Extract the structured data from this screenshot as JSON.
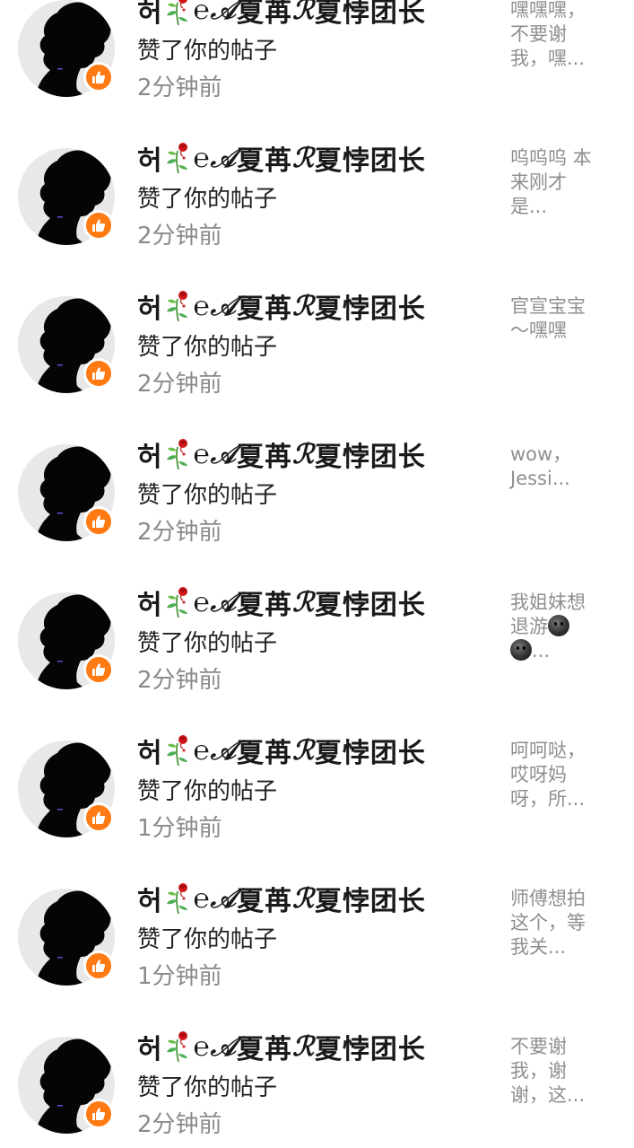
{
  "notifications": [
    {
      "name_prefix": "허",
      "name_script": "℮𝒜",
      "name_mid": "夏苒",
      "name_script2": "ℛ",
      "name_suffix": "夏悖团长",
      "action": "赞了你的帖子",
      "time": "2分钟前",
      "preview_lines": [
        "嘿嘿嘿，",
        "不要谢",
        "我，嘿..."
      ]
    },
    {
      "name_prefix": "허",
      "name_script": "℮𝒜",
      "name_mid": "夏苒",
      "name_script2": "ℛ",
      "name_suffix": "夏悖团长",
      "action": "赞了你的帖子",
      "time": "2分钟前",
      "preview_lines": [
        "呜呜呜  本",
        "来刚才",
        "是..."
      ]
    },
    {
      "name_prefix": "허",
      "name_script": "℮𝒜",
      "name_mid": "夏苒",
      "name_script2": "ℛ",
      "name_suffix": "夏悖团长",
      "action": "赞了你的帖子",
      "time": "2分钟前",
      "preview_lines": [
        "官宣宝宝",
        "～嘿嘿"
      ]
    },
    {
      "name_prefix": "허",
      "name_script": "℮𝒜",
      "name_mid": "夏苒",
      "name_script2": "ℛ",
      "name_suffix": "夏悖团长",
      "action": "赞了你的帖子",
      "time": "2分钟前",
      "preview_lines": [
        "wow，",
        "Jessi..."
      ]
    },
    {
      "name_prefix": "허",
      "name_script": "℮𝒜",
      "name_mid": "夏苒",
      "name_script2": "ℛ",
      "name_suffix": "夏悖团长",
      "action": "赞了你的帖子",
      "time": "2分钟前",
      "preview_lines": [
        "我姐妹想",
        "退游",
        "..."
      ],
      "has_emoji": true
    },
    {
      "name_prefix": "허",
      "name_script": "℮𝒜",
      "name_mid": "夏苒",
      "name_script2": "ℛ",
      "name_suffix": "夏悖团长",
      "action": "赞了你的帖子",
      "time": "1分钟前",
      "preview_lines": [
        "呵呵哒，",
        "哎呀妈",
        "呀，所..."
      ]
    },
    {
      "name_prefix": "허",
      "name_script": "℮𝒜",
      "name_mid": "夏苒",
      "name_script2": "ℛ",
      "name_suffix": "夏悖团长",
      "action": "赞了你的帖子",
      "time": "1分钟前",
      "preview_lines": [
        "师傅想拍",
        "这个，等",
        "我关..."
      ]
    },
    {
      "name_prefix": "허",
      "name_script": "℮𝒜",
      "name_mid": "夏苒",
      "name_script2": "ℛ",
      "name_suffix": "夏悖团长",
      "action": "赞了你的帖子",
      "time": "2分钟前",
      "preview_lines": [
        "不要谢",
        "我，谢",
        "谢，这..."
      ]
    }
  ],
  "icons": {
    "avatar": "silhouette-avatar-icon",
    "badge": "thumbs-up-icon",
    "flower": "wilted-rose-icon",
    "emoji": "dark-smile-emoji-icon"
  },
  "colors": {
    "badge": "#ff7a12",
    "name": "#1a1a1a",
    "time": "#8a8a8a",
    "preview": "#8f8f8f"
  }
}
